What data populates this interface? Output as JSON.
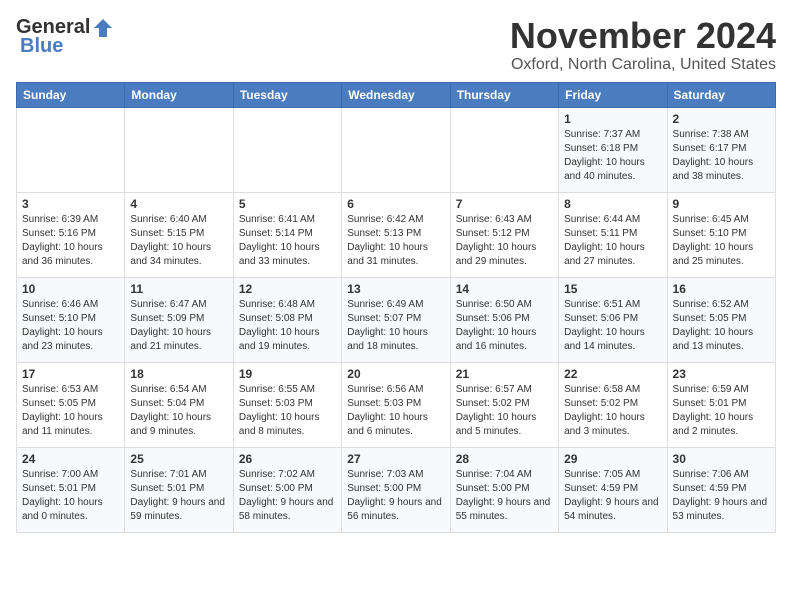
{
  "logo": {
    "general": "General",
    "blue": "Blue"
  },
  "title": "November 2024",
  "location": "Oxford, North Carolina, United States",
  "days_of_week": [
    "Sunday",
    "Monday",
    "Tuesday",
    "Wednesday",
    "Thursday",
    "Friday",
    "Saturday"
  ],
  "weeks": [
    [
      {
        "day": "",
        "info": ""
      },
      {
        "day": "",
        "info": ""
      },
      {
        "day": "",
        "info": ""
      },
      {
        "day": "",
        "info": ""
      },
      {
        "day": "",
        "info": ""
      },
      {
        "day": "1",
        "info": "Sunrise: 7:37 AM\nSunset: 6:18 PM\nDaylight: 10 hours and 40 minutes."
      },
      {
        "day": "2",
        "info": "Sunrise: 7:38 AM\nSunset: 6:17 PM\nDaylight: 10 hours and 38 minutes."
      }
    ],
    [
      {
        "day": "3",
        "info": "Sunrise: 6:39 AM\nSunset: 5:16 PM\nDaylight: 10 hours and 36 minutes."
      },
      {
        "day": "4",
        "info": "Sunrise: 6:40 AM\nSunset: 5:15 PM\nDaylight: 10 hours and 34 minutes."
      },
      {
        "day": "5",
        "info": "Sunrise: 6:41 AM\nSunset: 5:14 PM\nDaylight: 10 hours and 33 minutes."
      },
      {
        "day": "6",
        "info": "Sunrise: 6:42 AM\nSunset: 5:13 PM\nDaylight: 10 hours and 31 minutes."
      },
      {
        "day": "7",
        "info": "Sunrise: 6:43 AM\nSunset: 5:12 PM\nDaylight: 10 hours and 29 minutes."
      },
      {
        "day": "8",
        "info": "Sunrise: 6:44 AM\nSunset: 5:11 PM\nDaylight: 10 hours and 27 minutes."
      },
      {
        "day": "9",
        "info": "Sunrise: 6:45 AM\nSunset: 5:10 PM\nDaylight: 10 hours and 25 minutes."
      }
    ],
    [
      {
        "day": "10",
        "info": "Sunrise: 6:46 AM\nSunset: 5:10 PM\nDaylight: 10 hours and 23 minutes."
      },
      {
        "day": "11",
        "info": "Sunrise: 6:47 AM\nSunset: 5:09 PM\nDaylight: 10 hours and 21 minutes."
      },
      {
        "day": "12",
        "info": "Sunrise: 6:48 AM\nSunset: 5:08 PM\nDaylight: 10 hours and 19 minutes."
      },
      {
        "day": "13",
        "info": "Sunrise: 6:49 AM\nSunset: 5:07 PM\nDaylight: 10 hours and 18 minutes."
      },
      {
        "day": "14",
        "info": "Sunrise: 6:50 AM\nSunset: 5:06 PM\nDaylight: 10 hours and 16 minutes."
      },
      {
        "day": "15",
        "info": "Sunrise: 6:51 AM\nSunset: 5:06 PM\nDaylight: 10 hours and 14 minutes."
      },
      {
        "day": "16",
        "info": "Sunrise: 6:52 AM\nSunset: 5:05 PM\nDaylight: 10 hours and 13 minutes."
      }
    ],
    [
      {
        "day": "17",
        "info": "Sunrise: 6:53 AM\nSunset: 5:05 PM\nDaylight: 10 hours and 11 minutes."
      },
      {
        "day": "18",
        "info": "Sunrise: 6:54 AM\nSunset: 5:04 PM\nDaylight: 10 hours and 9 minutes."
      },
      {
        "day": "19",
        "info": "Sunrise: 6:55 AM\nSunset: 5:03 PM\nDaylight: 10 hours and 8 minutes."
      },
      {
        "day": "20",
        "info": "Sunrise: 6:56 AM\nSunset: 5:03 PM\nDaylight: 10 hours and 6 minutes."
      },
      {
        "day": "21",
        "info": "Sunrise: 6:57 AM\nSunset: 5:02 PM\nDaylight: 10 hours and 5 minutes."
      },
      {
        "day": "22",
        "info": "Sunrise: 6:58 AM\nSunset: 5:02 PM\nDaylight: 10 hours and 3 minutes."
      },
      {
        "day": "23",
        "info": "Sunrise: 6:59 AM\nSunset: 5:01 PM\nDaylight: 10 hours and 2 minutes."
      }
    ],
    [
      {
        "day": "24",
        "info": "Sunrise: 7:00 AM\nSunset: 5:01 PM\nDaylight: 10 hours and 0 minutes."
      },
      {
        "day": "25",
        "info": "Sunrise: 7:01 AM\nSunset: 5:01 PM\nDaylight: 9 hours and 59 minutes."
      },
      {
        "day": "26",
        "info": "Sunrise: 7:02 AM\nSunset: 5:00 PM\nDaylight: 9 hours and 58 minutes."
      },
      {
        "day": "27",
        "info": "Sunrise: 7:03 AM\nSunset: 5:00 PM\nDaylight: 9 hours and 56 minutes."
      },
      {
        "day": "28",
        "info": "Sunrise: 7:04 AM\nSunset: 5:00 PM\nDaylight: 9 hours and 55 minutes."
      },
      {
        "day": "29",
        "info": "Sunrise: 7:05 AM\nSunset: 4:59 PM\nDaylight: 9 hours and 54 minutes."
      },
      {
        "day": "30",
        "info": "Sunrise: 7:06 AM\nSunset: 4:59 PM\nDaylight: 9 hours and 53 minutes."
      }
    ]
  ]
}
